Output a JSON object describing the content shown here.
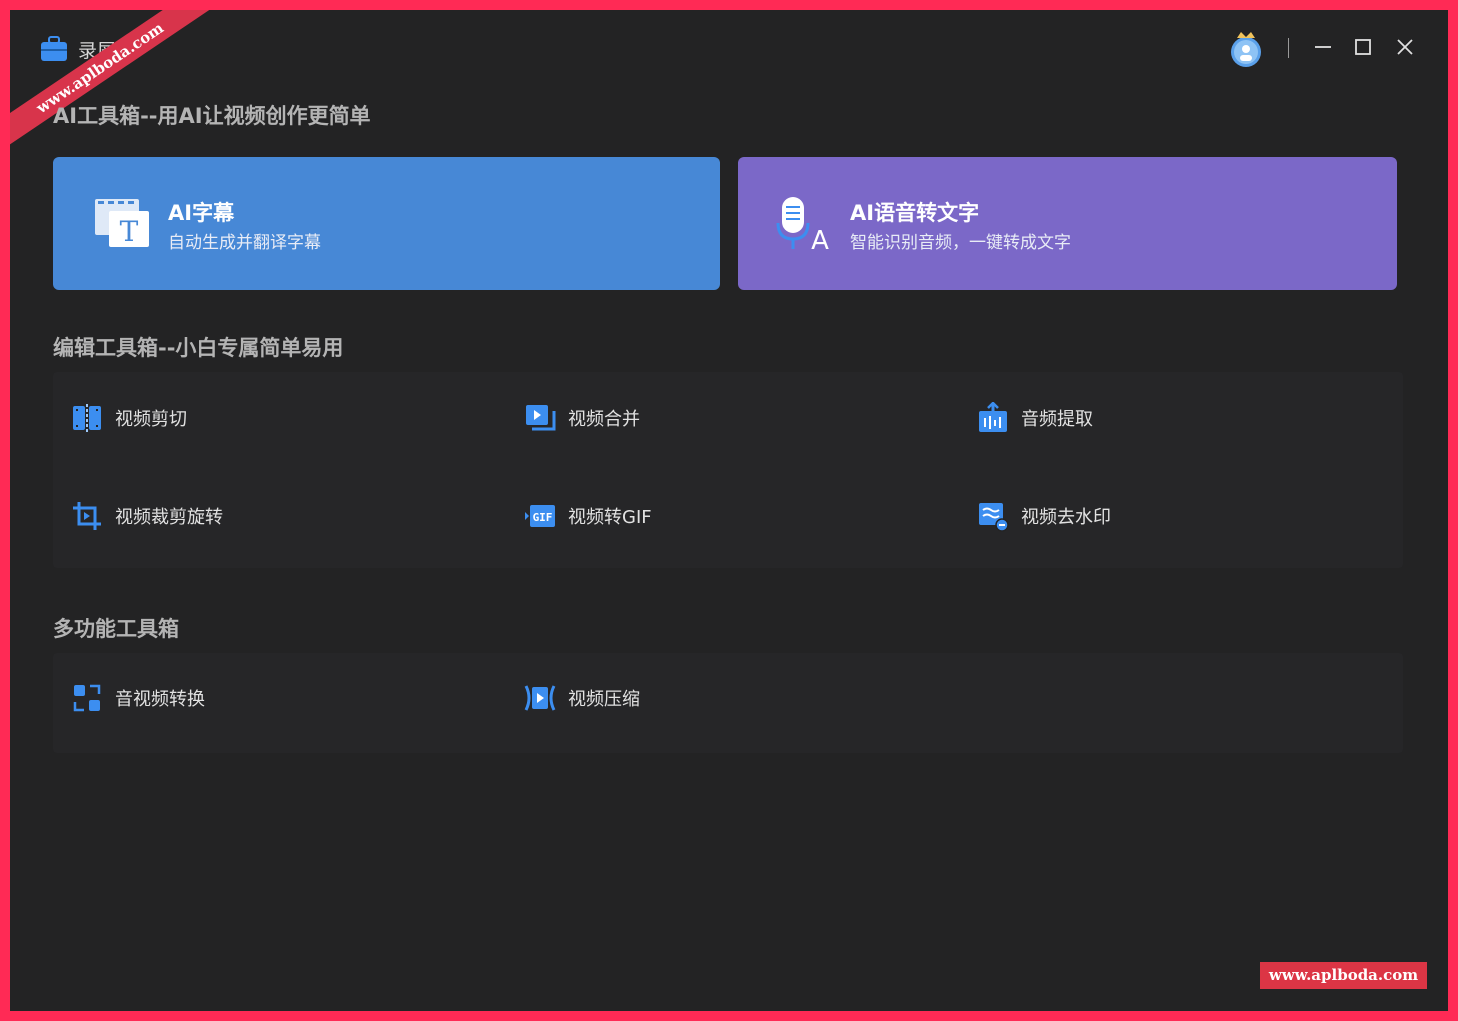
{
  "app": {
    "title": "录屏"
  },
  "watermark": {
    "corner_text": "www.aplboda.com",
    "bottom_text": "www.aplboda.com"
  },
  "sections": {
    "ai": "AI工具箱--用AI让视频创作更简单",
    "edit": "编辑工具箱--小白专属简单易用",
    "multi": "多功能工具箱"
  },
  "ai_cards": {
    "subtitle": {
      "title": "AI字幕",
      "desc": "自动生成并翻译字幕",
      "icon": "subtitle-t-icon"
    },
    "speech": {
      "title": "AI语音转文字",
      "desc": "智能识别音频，一键转成文字",
      "icon": "microphone-text-icon"
    }
  },
  "edit_tools": [
    {
      "label": "视频剪切",
      "icon": "video-cut-icon"
    },
    {
      "label": "视频合并",
      "icon": "video-merge-icon"
    },
    {
      "label": "音频提取",
      "icon": "audio-extract-icon"
    },
    {
      "label": "视频裁剪旋转",
      "icon": "crop-rotate-icon"
    },
    {
      "label": "视频转GIF",
      "icon": "gif-icon"
    },
    {
      "label": "视频去水印",
      "icon": "remove-watermark-icon"
    }
  ],
  "multi_tools": [
    {
      "label": "音视频转换",
      "icon": "convert-icon"
    },
    {
      "label": "视频压缩",
      "icon": "compress-icon"
    }
  ],
  "colors": {
    "background": "#232324",
    "accent_blue": "#4788d6",
    "accent_purple": "#7b68c8",
    "icon_blue": "#3c8ef0",
    "frame": "#ff2a55"
  }
}
